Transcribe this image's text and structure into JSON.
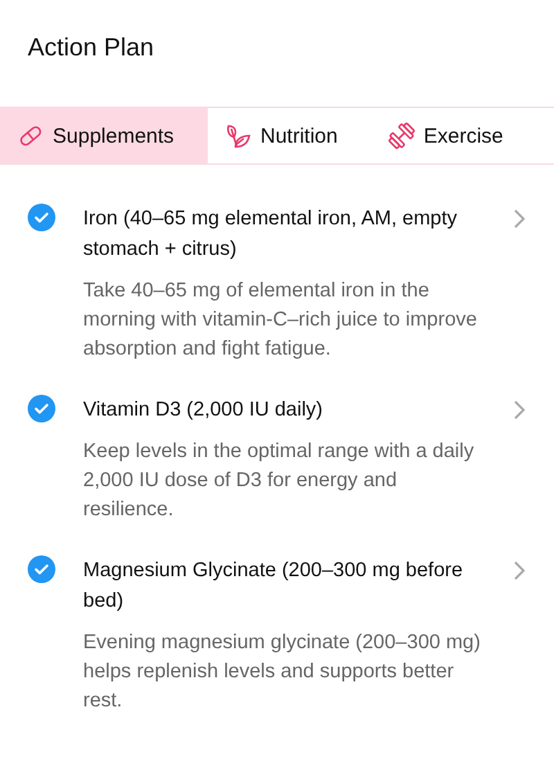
{
  "header": {
    "title": "Action Plan"
  },
  "tabs": [
    {
      "label": "Supplements",
      "kind": "pill",
      "selected": true
    },
    {
      "label": "Nutrition",
      "kind": "leaf",
      "selected": false
    },
    {
      "label": "Exercise",
      "kind": "dumbbell",
      "selected": false
    }
  ],
  "items": [
    {
      "title": "Iron (40–65 mg elemental iron, AM, empty stomach + citrus)",
      "description": "Take 40–65 mg of elemental iron in the morning with vitamin-C–rich juice to improve absorption and fight fatigue.",
      "checked": true
    },
    {
      "title": "Vitamin D3 (2,000 IU daily)",
      "description": "Keep levels in the optimal range with a daily 2,000 IU dose of D3 for energy and resilience.",
      "checked": true
    },
    {
      "title": "Magnesium Glycinate (200–300 mg before bed)",
      "description": "Evening magnesium glycinate (200–300 mg) helps replenish levels and supports better rest.",
      "checked": true
    }
  ]
}
